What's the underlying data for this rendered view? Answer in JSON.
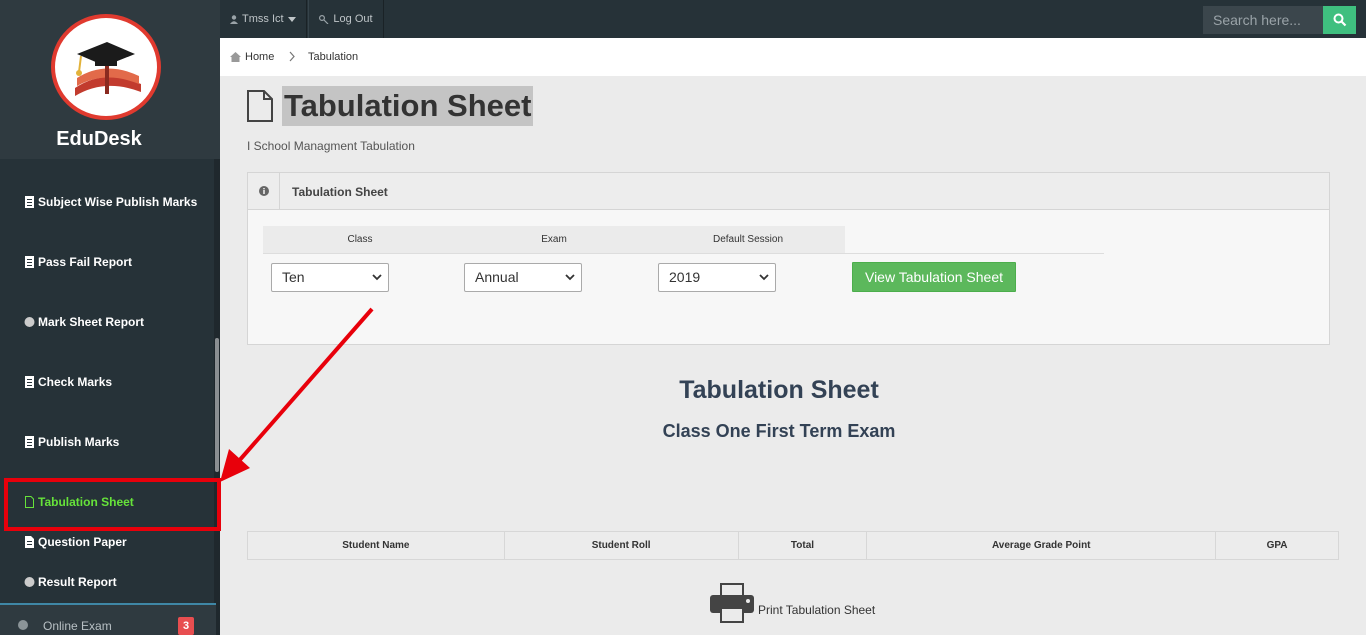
{
  "brand": {
    "name": "EduDesk"
  },
  "sidebar": {
    "items": [
      {
        "label": "Subject Wise Publish Marks",
        "icon": "document-icon"
      },
      {
        "label": "Pass Fail Report",
        "icon": "document-icon"
      },
      {
        "label": "Mark Sheet Report",
        "icon": "circle-icon"
      },
      {
        "label": "Check Marks",
        "icon": "document-icon"
      },
      {
        "label": "Publish Marks",
        "icon": "document-icon"
      },
      {
        "label": "Tabulation Sheet",
        "icon": "file-outline-icon",
        "active": true
      },
      {
        "label": "Question Paper",
        "icon": "file-text-icon"
      },
      {
        "label": "Result Report",
        "icon": "circle-icon"
      }
    ],
    "online_exam": {
      "label": "Online Exam",
      "badge": "3"
    }
  },
  "topbar": {
    "user_label": "Tmss Ict",
    "logout_label": "Log Out",
    "search_placeholder": "Search here..."
  },
  "breadcrumb": {
    "home": "Home",
    "current": "Tabulation"
  },
  "page": {
    "title": "Tabulation Sheet",
    "subtitle": "I School Managment Tabulation"
  },
  "panel": {
    "title": "Tabulation Sheet",
    "columns": {
      "class": "Class",
      "exam": "Exam",
      "session": "Default Session"
    },
    "values": {
      "class": "Ten",
      "exam": "Annual",
      "session": "2019"
    },
    "button": "View Tabulation Sheet"
  },
  "result": {
    "title": "Tabulation Sheet",
    "subtitle": "Class One First Term Exam",
    "headers": [
      "Student Name",
      "Student Roll",
      "Total",
      "Average Grade Point",
      "GPA"
    ],
    "print_label": "Print Tabulation Sheet"
  },
  "colors": {
    "accent_green": "#5cb85c",
    "active_menu": "#66e23a",
    "annotation_red": "#e8000b",
    "sidebar_bg": "#263238"
  }
}
